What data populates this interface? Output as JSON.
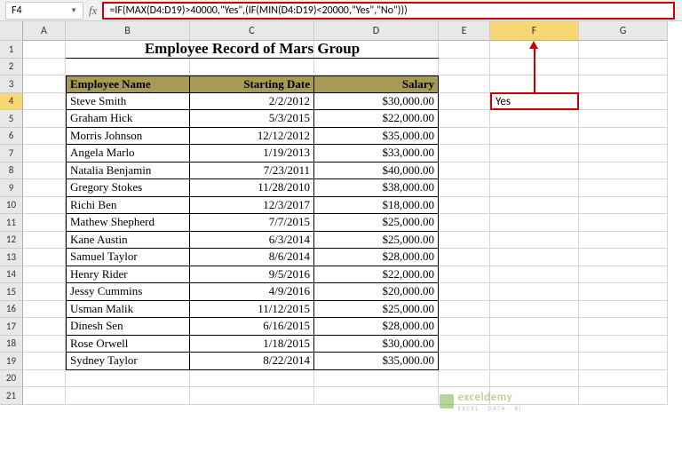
{
  "name_box": "F4",
  "formula_bar": "=IF(MAX(D4:D19)>40000,\"Yes\",(IF(MIN(D4:D19)<20000,\"Yes\",\"No\")))",
  "columns": [
    "A",
    "B",
    "C",
    "D",
    "E",
    "F",
    "G"
  ],
  "rows": [
    "1",
    "2",
    "3",
    "4",
    "5",
    "6",
    "7",
    "8",
    "9",
    "10",
    "11",
    "12",
    "13",
    "14",
    "15",
    "16",
    "17",
    "18",
    "19",
    "20",
    "21"
  ],
  "title": "Employee Record of Mars Group",
  "headers": {
    "name": "Employee Name",
    "date": "Starting Date",
    "salary": "Salary"
  },
  "table": [
    {
      "name": "Steve Smith",
      "date": "2/2/2012",
      "salary": "$30,000.00"
    },
    {
      "name": "Graham Hick",
      "date": "5/3/2015",
      "salary": "$22,000.00"
    },
    {
      "name": "Morris Johnson",
      "date": "12/12/2012",
      "salary": "$35,000.00"
    },
    {
      "name": "Angela Marlo",
      "date": "1/19/2013",
      "salary": "$33,000.00"
    },
    {
      "name": "Natalia Benjamin",
      "date": "7/23/2011",
      "salary": "$40,000.00"
    },
    {
      "name": "Gregory Stokes",
      "date": "11/28/2010",
      "salary": "$38,000.00"
    },
    {
      "name": "Richi Ben",
      "date": "12/3/2017",
      "salary": "$18,000.00"
    },
    {
      "name": "Mathew Shepherd",
      "date": "7/7/2015",
      "salary": "$25,000.00"
    },
    {
      "name": "Kane Austin",
      "date": "6/3/2014",
      "salary": "$25,000.00"
    },
    {
      "name": "Samuel Taylor",
      "date": "8/6/2014",
      "salary": "$28,000.00"
    },
    {
      "name": "Henry Rider",
      "date": "9/5/2016",
      "salary": "$22,000.00"
    },
    {
      "name": "Jessy Cummins",
      "date": "4/9/2016",
      "salary": "$20,000.00"
    },
    {
      "name": "Usman Malik",
      "date": "11/12/2015",
      "salary": "$25,000.00"
    },
    {
      "name": "Dinesh Sen",
      "date": "6/16/2015",
      "salary": "$28,000.00"
    },
    {
      "name": "Rose Orwell",
      "date": "1/18/2015",
      "salary": "$30,000.00"
    },
    {
      "name": "Sydney Taylor",
      "date": "8/22/2014",
      "salary": "$35,000.00"
    }
  ],
  "result_cell": "Yes",
  "watermark": {
    "brand": "exceldemy",
    "tagline": "EXCEL · DATA · BI"
  }
}
